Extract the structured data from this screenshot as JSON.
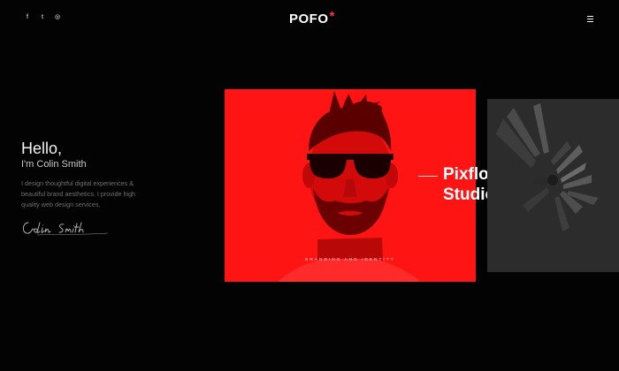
{
  "header": {
    "social": [
      {
        "icon": "facebook-icon",
        "glyph": "f"
      },
      {
        "icon": "twitter-icon",
        "glyph": "t"
      },
      {
        "icon": "dribbble-icon",
        "glyph": "◎"
      }
    ],
    "logo_text": "POFO",
    "logo_star": "*",
    "menu_icon": "hamburger-menu-icon"
  },
  "intro": {
    "greeting": "Hello,",
    "name": "I'm Colin Smith",
    "description": "I design thoughtful digital experiences & beautiful brand aesthetics. I provide high quality web design services.",
    "signature": "Colin Smith"
  },
  "featured": {
    "caption": "BRANDING AND IDENTITY",
    "title_line1": "Pixflow",
    "title_line2": "Studio"
  },
  "colors": {
    "background": "#030303",
    "accent": "#ff2e4f",
    "card_red": "#ff1414",
    "card_dark": "#2c2c2c"
  }
}
